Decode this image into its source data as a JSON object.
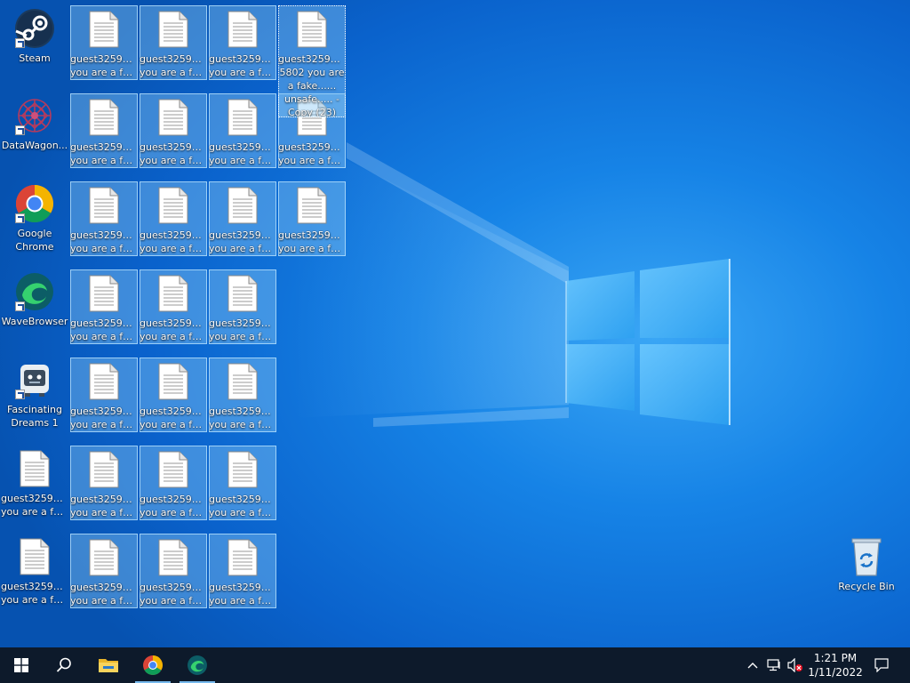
{
  "desktop": {
    "app_icons": [
      {
        "name": "Steam",
        "line2": "",
        "icon": "steam-icon"
      },
      {
        "name": "DataWagon...",
        "line2": "",
        "icon": "datawagon-icon"
      },
      {
        "name": "Google",
        "line2": "Chrome",
        "icon": "chrome-icon"
      },
      {
        "name": "WaveBrowser",
        "line2": "",
        "icon": "wavebrowser-icon"
      },
      {
        "name": "Fascinating",
        "line2": "Dreams 1",
        "icon": "fascinating-dreams-icon"
      }
    ],
    "file_label_1": "guest32590...",
    "file_label_2": "you are a fa...",
    "focused_file_label": "guest3259023 5802 you are a fake...... unsafe..... - Copy (23)",
    "recycle_bin": "Recycle Bin"
  },
  "taskbar": {
    "start": "windows-start-icon",
    "search": "search-icon",
    "pinned": [
      "file-explorer-icon",
      "chrome-icon",
      "wavebrowser-icon"
    ],
    "tray": [
      "chevron-up-icon",
      "network-icon",
      "volume-muted-icon"
    ],
    "time": "1:21 PM",
    "date": "1/11/2022",
    "notifications": "notification-icon"
  },
  "colors": {
    "wallpaper": "#0b68d4",
    "taskbar": "#0d1a2b",
    "selection": "#87c8f5",
    "accent": "#76b9ed"
  }
}
